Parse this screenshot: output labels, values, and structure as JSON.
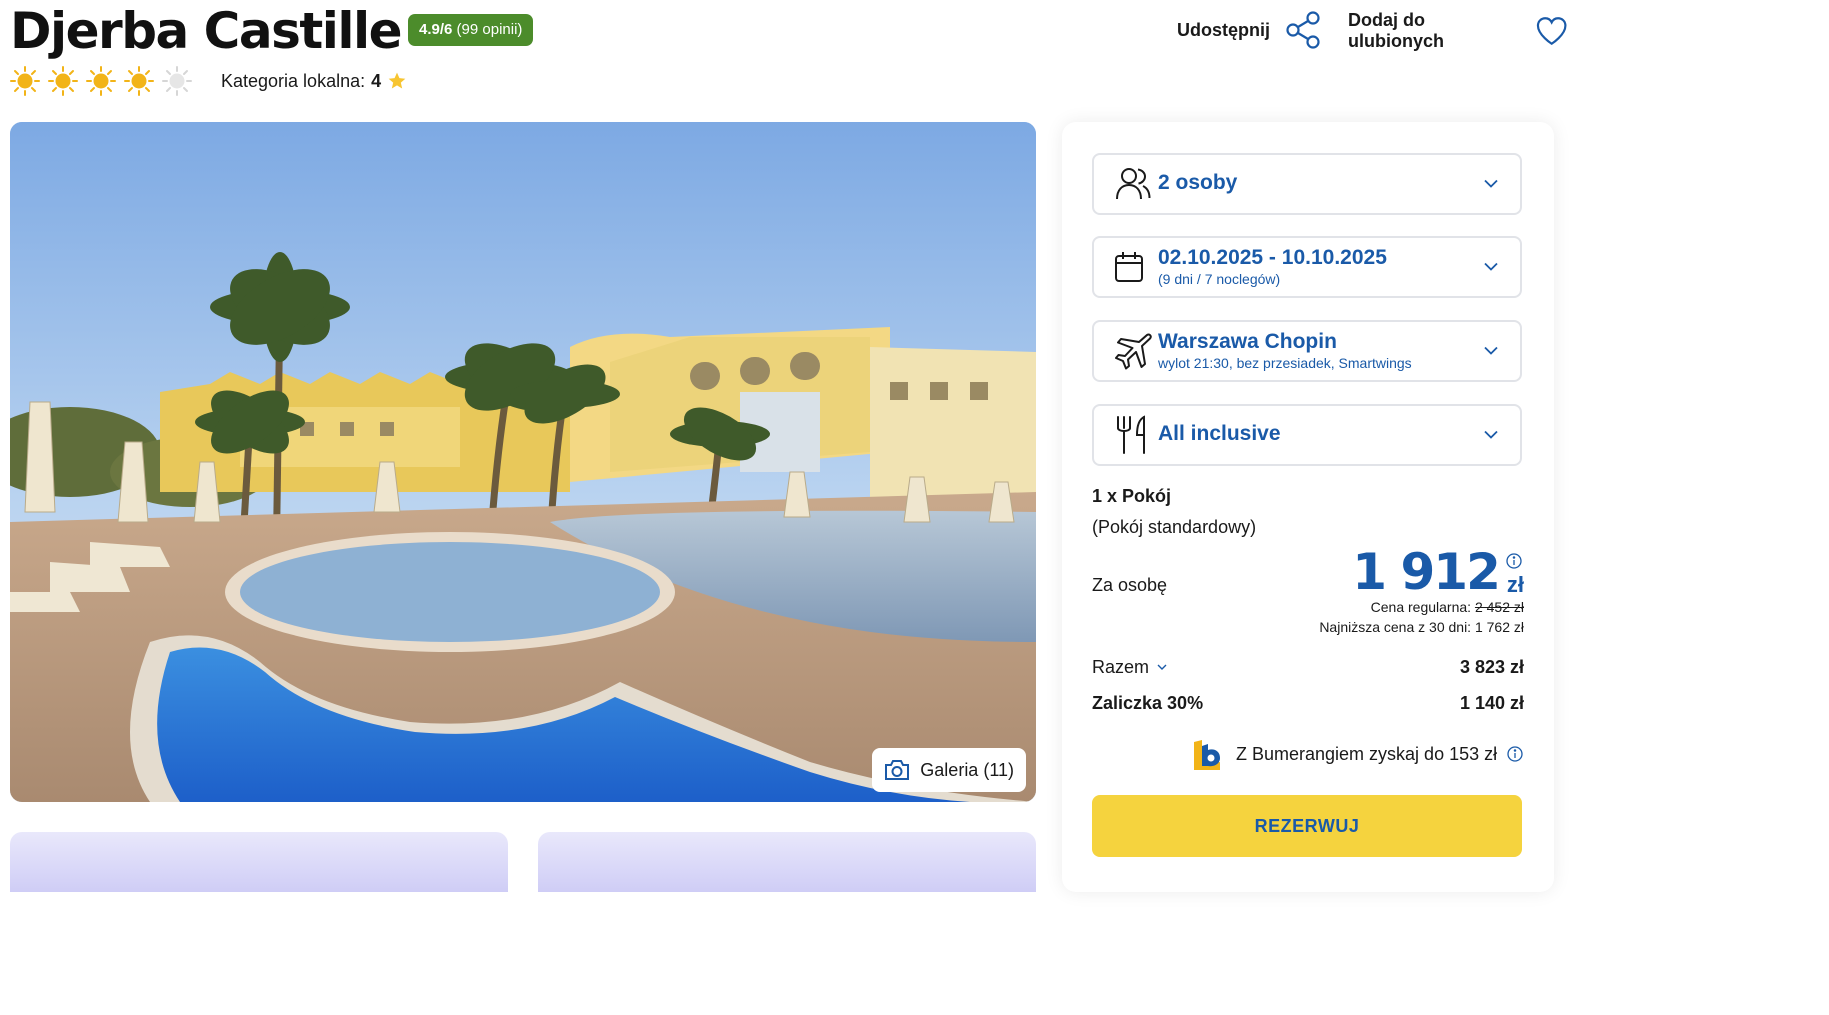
{
  "hotel": {
    "name": "Djerba Castille",
    "rating_score": "4.9/6",
    "rating_count": "(99 opinii)",
    "stars_filled": 4,
    "stars_total": 5,
    "local_category_label": "Kategoria lokalna:",
    "local_category_value": "4"
  },
  "actions": {
    "share_label": "Udostępnij",
    "favorite_label": "Dodaj do ulubionych"
  },
  "gallery": {
    "button_label": "Galeria (11)"
  },
  "booking": {
    "persons": "2 osoby",
    "dates": "02.10.2025 - 10.10.2025",
    "duration": "(9 dni / 7 noclegów)",
    "departure_airport": "Warszawa Chopin",
    "flight_details": "wylot 21:30, bez przesiadek, Smartwings",
    "board": "All inclusive",
    "room_count": "1 x Pokój",
    "room_type": "(Pokój standardowy)",
    "per_person_label": "Za osobę",
    "price": "1 912",
    "currency": "zł",
    "regular_price_label": "Cena regularna:",
    "regular_price": "2 452 zł",
    "lowest_price_text": "Najniższa cena z 30 dni: 1 762 zł",
    "total_label": "Razem",
    "total_value": "3 823 zł",
    "deposit_label": "Zaliczka 30%",
    "deposit_value": "1 140 zł",
    "bumerang_text": "Z Bumerangiem zyskaj do 153 zł",
    "book_button": "REZERWUJ"
  },
  "colors": {
    "brand_blue": "#1a5aa8",
    "rating_green": "#4c8c2b",
    "cta_yellow": "#f5d33e",
    "sun_yellow": "#f2b418"
  },
  "icons": {
    "share": "share-icon",
    "favorite": "heart-icon",
    "persons": "users-icon",
    "dates": "calendar-icon",
    "flight": "plane-icon",
    "board": "fork-knife-icon",
    "gallery": "camera-icon",
    "info": "info-icon",
    "chevron": "chevron-down-icon",
    "bumerang": "bumerang-logo-icon",
    "local_star": "star-icon"
  }
}
